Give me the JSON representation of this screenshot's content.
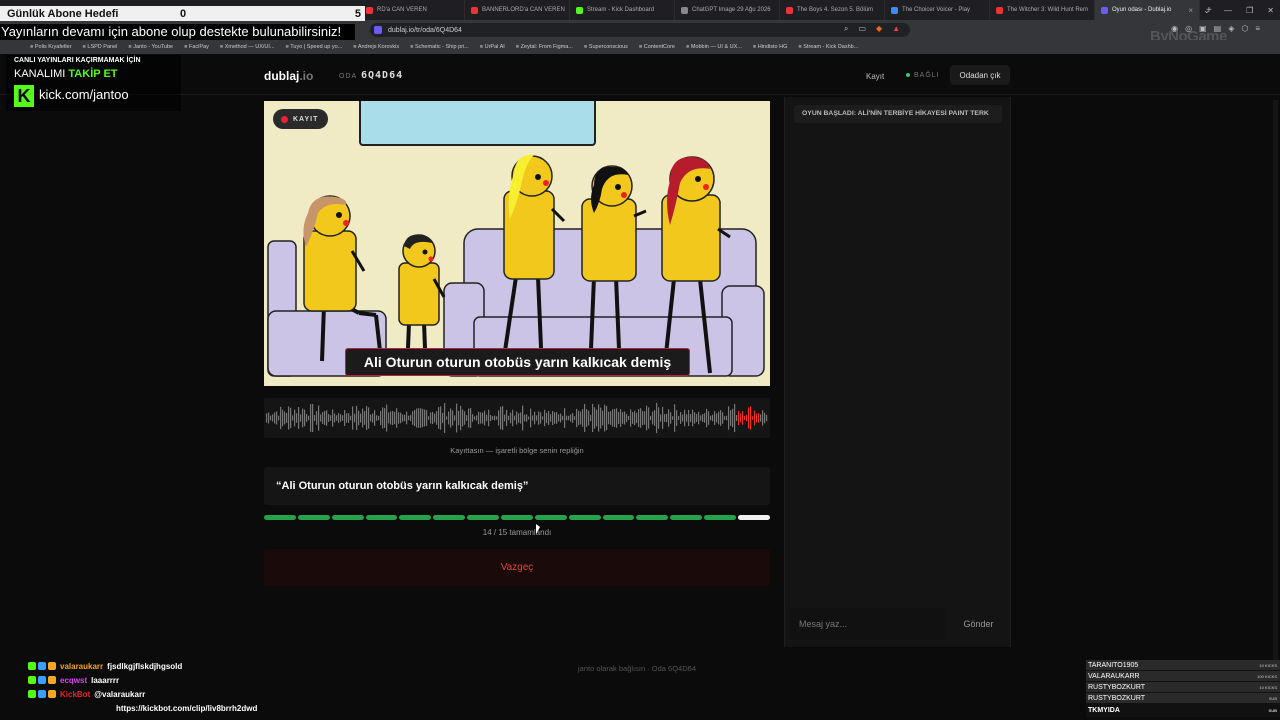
{
  "browser": {
    "tabs": [
      {
        "label": "RD'a CAN VEREN",
        "fav_color": "#e33",
        "active": false
      },
      {
        "label": "BANNERLORD'a CAN VEREN",
        "fav_color": "#e33",
        "active": false
      },
      {
        "label": "Stream - Kick Dashboard",
        "fav_color": "#53fc18",
        "active": false
      },
      {
        "label": "ChatGPT Image 29 Ağu 2026",
        "fav_color": "#888",
        "active": false
      },
      {
        "label": "The Boys 4. Sezon 5. Bölüm",
        "fav_color": "#e33",
        "active": false
      },
      {
        "label": "The Choicer Voicer - Play",
        "fav_color": "#48f",
        "active": false
      },
      {
        "label": "The Witcher 3: Wild Hunt Rem",
        "fav_color": "#e33",
        "active": false
      },
      {
        "label": "Oyun odası - Dublaj.io",
        "fav_color": "#6b5cff",
        "active": true
      }
    ],
    "new_tab": "+",
    "url": "dublaj.io/tr/oda/6Q4D64",
    "bookmarks": [
      "Polis Kıyafetler",
      "LSPD Panel",
      "Janto - YouTube",
      "FaciPay",
      "Xmethod — UX/UI...",
      "Tuyo | Speed up yo...",
      "Andrejs Korovkis",
      "Schematic - Ship pri...",
      "UrPal AI",
      "Zeytal: From Figma...",
      "Superconscious",
      "ContentCore",
      "Mobbin — UI & UX...",
      "Hindisto HG",
      "Stream - Kick Dashb..."
    ],
    "watermark": "ByNoGame"
  },
  "overlay": {
    "sub_goal": {
      "label": "Günlük Abone Hedefi",
      "current": "0",
      "target": "5"
    },
    "ticker": "Yayınların devamı için abone olup destekte bulunabilirsiniz!",
    "kick": {
      "line1": "CANLI YAYINLARI KAÇIRMAMAK İÇİN",
      "line2_pre": "KANALIMI ",
      "line2_em": "TAKİP ET",
      "logo": "K",
      "url": "kick.com/jantoo"
    },
    "chat": [
      {
        "user": "valaraukarr",
        "user_color": "#f5a623",
        "message": "fjsdlkgjflskdjhgsold"
      },
      {
        "user": "ecqwst",
        "user_color": "#e040fb",
        "message": "laaarrrr"
      },
      {
        "user": "KickBot",
        "user_color": "#e22",
        "message": "@valaraukarr"
      },
      {
        "user": "",
        "user_color": "#fff",
        "message": "https://kickbot.com/clip/liv8brrh2dwd"
      }
    ],
    "leaderboard": [
      {
        "name": "TARANITO1905",
        "amount": "10 KICKS"
      },
      {
        "name": "VALARAUKARR",
        "amount": "100 KICKS"
      },
      {
        "name": "RUSTYBOZKURT",
        "amount": "10 KICKS"
      },
      {
        "name": "RUSTYBOZKURT",
        "amount": "SUB"
      },
      {
        "name": "TKMYIDA",
        "amount": "SUB"
      }
    ]
  },
  "app": {
    "logo_main": "dublaj",
    "logo_suffix": ".io",
    "room_label": "ODA",
    "room_code": "6Q4D64",
    "nav_record": "Kayıt",
    "nav_status": "BAĞLI",
    "leave_button": "Odadan çık",
    "rec_badge": "KAYIT",
    "subtitle": "Ali Oturun oturun otobüs yarın kalkıcak demiş",
    "wave_caption": "Kayıttasın — işaretli bölge senin repliğin",
    "current_line": "“Ali Oturun oturun otobüs yarın kalkıcak demiş”",
    "progress": {
      "done": 14,
      "total": 15,
      "text": "14 / 15 tamamlandı"
    },
    "cancel_button": "Vazgeç",
    "footer": "janto olarak bağlısın · Oda 6Q4D64",
    "system_message": "OYUN BAŞLADI: ALİ'NİN TERBİYE HİKAYESİ PAINT TERK",
    "message_placeholder": "Mesaj yaz...",
    "send_button": "Gönder"
  },
  "colors": {
    "accent_green": "#26a24a",
    "danger_red": "#e0443a",
    "kick_green": "#53fc18",
    "sofa": "#cbc4e6",
    "figure_yellow": "#f2c81c"
  }
}
